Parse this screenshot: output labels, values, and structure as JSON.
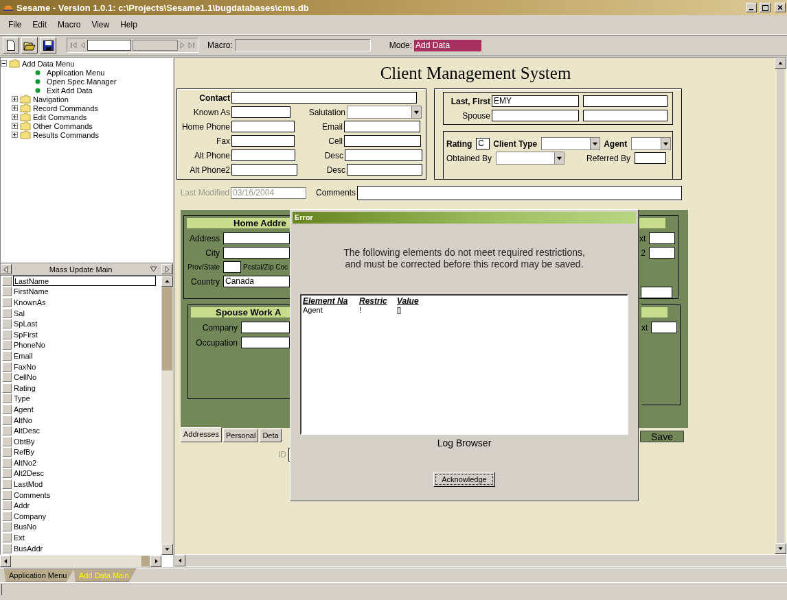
{
  "window": {
    "title": "Sesame - Version 1.0.1: c:\\Projects\\Sesame1.1\\bugdatabases\\cms.db"
  },
  "menu": [
    "File",
    "Edit",
    "Macro",
    "View",
    "Help"
  ],
  "toolbar": {
    "macro_label": "Macro:",
    "mode_label": "Mode:",
    "mode_value": "Add Data"
  },
  "tree": [
    {
      "label": "Add Data Menu",
      "kind": "folder",
      "expanded": true,
      "children": [
        {
          "label": "Application Menu",
          "kind": "command"
        },
        {
          "label": "Open Spec Manager",
          "kind": "command"
        },
        {
          "label": "Exit Add Data",
          "kind": "command"
        },
        {
          "label": "Navigation",
          "kind": "folder",
          "expanded": false
        },
        {
          "label": "Record Commands",
          "kind": "folder",
          "expanded": false
        },
        {
          "label": "Edit Commands",
          "kind": "folder",
          "expanded": false
        },
        {
          "label": "Other Commands",
          "kind": "folder",
          "expanded": false
        },
        {
          "label": "Results Commands",
          "kind": "folder",
          "expanded": false
        }
      ]
    }
  ],
  "mass_update": {
    "title": "Mass Update Main",
    "fields": [
      {
        "label": "LastName",
        "selected": true
      },
      {
        "label": "FirstName",
        "selected": false
      },
      {
        "label": "KnownAs",
        "selected": false
      },
      {
        "label": "Sal",
        "selected": false
      },
      {
        "label": "SpLast",
        "selected": false
      },
      {
        "label": "SpFirst",
        "selected": false
      },
      {
        "label": "PhoneNo",
        "selected": false
      },
      {
        "label": "Email",
        "selected": false
      },
      {
        "label": "FaxNo",
        "selected": false
      },
      {
        "label": "CellNo",
        "selected": false
      },
      {
        "label": "Rating",
        "selected": false
      },
      {
        "label": "Type",
        "selected": false
      },
      {
        "label": "Agent",
        "selected": false
      },
      {
        "label": "AltNo",
        "selected": false
      },
      {
        "label": "AltDesc",
        "selected": false
      },
      {
        "label": "ObtBy",
        "selected": false
      },
      {
        "label": "RefBy",
        "selected": false
      },
      {
        "label": "AltNo2",
        "selected": false
      },
      {
        "label": "Alt2Desc",
        "selected": false
      },
      {
        "label": "LastMod",
        "selected": false
      },
      {
        "label": "Comments",
        "selected": false
      },
      {
        "label": "Addr",
        "selected": false
      },
      {
        "label": "Company",
        "selected": false
      },
      {
        "label": "BusNo",
        "selected": false
      },
      {
        "label": "Ext",
        "selected": false
      },
      {
        "label": "BusAddr",
        "selected": false
      }
    ]
  },
  "form": {
    "title": "Client Management System",
    "contact_rows": [
      [
        {
          "label": "Contact",
          "kind": "text",
          "strong": true
        }
      ],
      [
        {
          "label": "Known As",
          "kind": "text",
          "strong": false
        },
        {
          "label": "Salutation",
          "kind": "dropdown",
          "strong": false
        }
      ],
      [
        {
          "label": "Home Phone",
          "kind": "text",
          "strong": false
        },
        {
          "label": "Email",
          "kind": "text",
          "strong": false
        }
      ],
      [
        {
          "label": "Fax",
          "kind": "text",
          "strong": false
        },
        {
          "label": "Cell",
          "kind": "text",
          "strong": false
        }
      ],
      [
        {
          "label": "Alt Phone",
          "kind": "text",
          "strong": false
        },
        {
          "label": "Desc",
          "kind": "text",
          "strong": false
        }
      ],
      [
        {
          "label": "Alt Phone2",
          "kind": "text",
          "strong": false
        },
        {
          "label": "Desc",
          "kind": "text",
          "strong": false
        }
      ]
    ],
    "name_rows": [
      {
        "label": "Last, First",
        "strong": true,
        "value": "EMY"
      },
      {
        "label": "Spouse",
        "strong": false
      }
    ],
    "class_rows": [
      [
        {
          "label": "Rating",
          "kind": "text",
          "strong": true,
          "value": "C"
        },
        {
          "label": "Client Type",
          "kind": "dropdown",
          "strong": true
        },
        {
          "label": "Agent",
          "kind": "dropdown",
          "strong": true
        }
      ],
      [
        {
          "label": "Obtained By",
          "kind": "dropdown",
          "strong": false
        },
        {
          "label": "Referred By",
          "kind": "text",
          "strong": false
        }
      ]
    ],
    "last_modified": {
      "label": "Last Modified",
      "value": "03/16/2004",
      "disabled": true
    },
    "comments": {
      "label": "Comments"
    },
    "groups": [
      {
        "heading": "Home Addre",
        "rows": [
          [
            {
              "label": "Address",
              "kind": "text"
            }
          ],
          [
            {
              "label": "City",
              "kind": "text"
            }
          ],
          [
            {
              "label": "Prov/State",
              "kind": "text"
            },
            {
              "label": "Postal/Zip Coc",
              "kind": "label"
            }
          ],
          [
            {
              "label": "Country",
              "kind": "text",
              "value": "Canada"
            }
          ]
        ]
      },
      {
        "rows": [
          [
            {
              "label": "xt",
              "kind": "text"
            }
          ],
          [
            {
              "label": "2",
              "kind": "text"
            }
          ],
          [
            {
              "kind": "text"
            }
          ]
        ]
      },
      {
        "heading": "Spouse Work A",
        "rows": [
          [
            {
              "label": "Company",
              "kind": "text"
            }
          ],
          [
            {
              "label": "Occupation",
              "kind": "text"
            }
          ]
        ]
      },
      {
        "rows": [
          [
            {
              "label": "xt",
              "kind": "text"
            }
          ]
        ]
      }
    ],
    "tabs": [
      {
        "label": "Addresses",
        "selected": true
      },
      {
        "label": "Personal",
        "selected": false
      },
      {
        "label": "Deta",
        "selected": false
      }
    ],
    "save_button": "Save",
    "id_label": "ID"
  },
  "dialog": {
    "title": "Error",
    "message": "The following elements do not meet required restrictions,\nand must be corrected before this record may be saved.",
    "columns": [
      "Element Na",
      "Restric",
      "Value"
    ],
    "rows": [
      [
        "Agent",
        "!",
        "[]"
      ]
    ],
    "caption": "Log Browser",
    "button": "Acknowledge"
  },
  "bottom_tabs": [
    {
      "label": "Application Menu",
      "selected": false
    },
    {
      "label": "Add Data Main",
      "selected": true
    }
  ]
}
